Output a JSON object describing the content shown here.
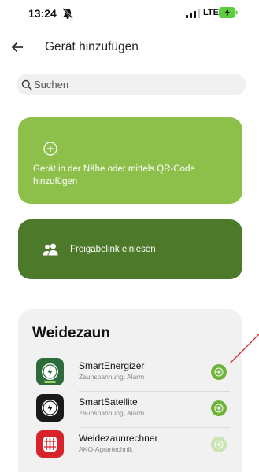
{
  "status_bar": {
    "time": "13:24",
    "network": "LTE",
    "bell_icon": "bell-muted-icon",
    "signal_icon": "cellular-signal-icon",
    "battery_icon": "battery-charging-icon",
    "battery_color": "#5ccf3c"
  },
  "header": {
    "back_icon": "arrow-left-icon",
    "title": "Gerät hinzufügen"
  },
  "search": {
    "icon": "search-icon",
    "placeholder": "Suchen",
    "value": ""
  },
  "actions": {
    "add_nearby": {
      "icon": "plus-circle-icon",
      "label": "Gerät in der Nähe oder mittels QR-Code hinzufügen",
      "color": "#8cc04a"
    },
    "share_link": {
      "icon": "people-icon",
      "label": "Freigabelink einlesen",
      "color": "#4d7a2a"
    }
  },
  "category": {
    "title": "Weidezaun",
    "devices": [
      {
        "name": "SmartEnergizer",
        "subtitle": "Zaunspannung, Alarm",
        "icon": "energizer-device-icon",
        "add_state": "active"
      },
      {
        "name": "SmartSatellite",
        "subtitle": "Zaunspannung, Alarm",
        "icon": "satellite-device-icon",
        "add_state": "active"
      },
      {
        "name": "Weidezaunrechner",
        "subtitle": "AKO-Agrartechnik",
        "icon": "fence-calculator-icon",
        "add_state": "faded"
      }
    ]
  },
  "accent_colors": {
    "green": "#6fb33a",
    "annotation": "#d62828"
  }
}
